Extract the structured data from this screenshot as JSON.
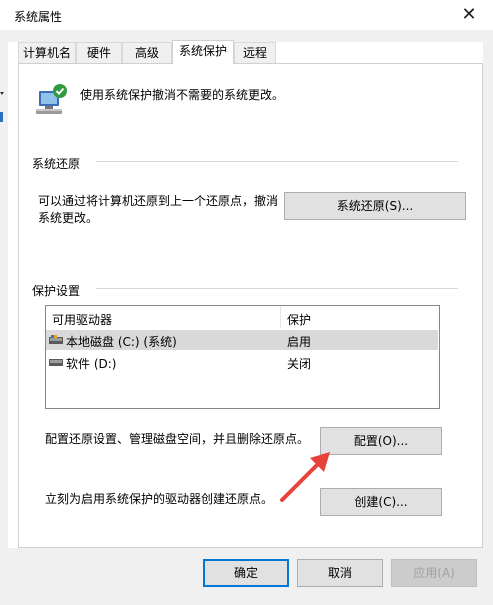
{
  "window": {
    "title": "系统属性",
    "close_glyph": "✕"
  },
  "tabs": [
    {
      "label": "计算机名"
    },
    {
      "label": "硬件"
    },
    {
      "label": "高级"
    },
    {
      "label": "系统保护"
    },
    {
      "label": "远程"
    }
  ],
  "active_tab": "系统保护",
  "intro_text": "使用系统保护撤消不需要的系统更改。",
  "system_restore": {
    "heading": "系统还原",
    "description_line1": "可以通过将计算机还原到上一个还原点，撤消",
    "description_line2": "系统更改。",
    "button_label": "系统还原(S)..."
  },
  "protection": {
    "heading": "保护设置",
    "columns": {
      "drive": "可用驱动器",
      "protection": "保护"
    },
    "drives": [
      {
        "name": "本地磁盘 (C:) (系统)",
        "status": "启用"
      },
      {
        "name": "软件 (D:)",
        "status": "关闭"
      }
    ],
    "configure_text": "配置还原设置、管理磁盘空间，并且删除还原点。",
    "configure_button": "配置(O)...",
    "create_text": "立刻为启用系统保护的驱动器创建还原点。",
    "create_button": "创建(C)..."
  },
  "footer": {
    "ok": "确定",
    "cancel": "取消",
    "apply": "应用(A)"
  },
  "colors": {
    "accent": "#0078d7",
    "arrow": "#e8413a",
    "selected_row": "#d9d9d9"
  },
  "icons": {
    "intro": "system-protection-icon",
    "drive_c": "system-drive-icon",
    "drive_d": "drive-icon",
    "close": "close-icon"
  }
}
